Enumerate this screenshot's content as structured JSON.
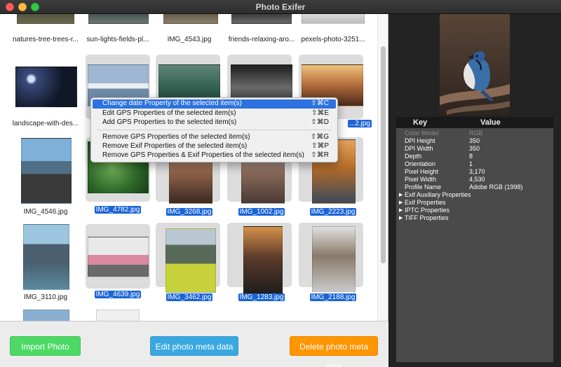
{
  "window": {
    "title": "Photo Exifer"
  },
  "gallery": {
    "row0_labels": [
      "natures-tree-trees-r...",
      "sun-lights-fields-pl...",
      "IMG_4543.jpg",
      "friends-relaxing-aro...",
      "pexels-photo-3251..."
    ],
    "row1_labels": [
      "landscape-with-des...",
      "",
      "",
      "",
      "...2.jpg"
    ],
    "row2_labels": [
      "IMG_4546.jpg",
      "IMG_4782.jpg",
      "IMG_3268.jpg",
      "IMG_1002.jpg",
      "IMG_2223.jpg"
    ],
    "row3_labels": [
      "IMG_3110.jpg",
      "IMG_4639.jpg",
      "IMG_3462.jpg",
      "IMG_1283.jpg",
      "IMG_2188.jpg"
    ]
  },
  "context_menu": {
    "items": [
      {
        "label": "Change date Property of the selected item(s)",
        "shortcut": "⇧⌘C"
      },
      {
        "label": "Edit GPS Properties of the selected item(s)",
        "shortcut": "⇧⌘E"
      },
      {
        "label": "Add GPS Properties to the selected item(s)",
        "shortcut": "⇧⌘D"
      },
      {
        "label": "Remove GPS Properties of the selected item(s)",
        "shortcut": "⇧⌘G"
      },
      {
        "label": "Remove Exif Properties of the selected item(s)",
        "shortcut": "⇧⌘P"
      },
      {
        "label": "Remove GPS Properties & Exif Properties of the selected item(s)",
        "shortcut": "⇧⌘R"
      }
    ]
  },
  "buttons": {
    "import": "Import Photo",
    "edit": "Edit photo meta data",
    "delete": "Delete photo meta data"
  },
  "metadata": {
    "key_header": "Key",
    "value_header": "Value",
    "rows": [
      {
        "key": "Color Model",
        "value": "RGB"
      },
      {
        "key": "DPI Height",
        "value": "350"
      },
      {
        "key": "DPI Width",
        "value": "350"
      },
      {
        "key": "Depth",
        "value": "8"
      },
      {
        "key": "Orientation",
        "value": "1"
      },
      {
        "key": "Pixel Height",
        "value": "3,170"
      },
      {
        "key": "Pixel Width",
        "value": "4,530"
      },
      {
        "key": "Profile Name",
        "value": "Adobe RGB (1998)"
      }
    ],
    "groups": [
      "Exif Auxiliary Properties",
      "Exif Properties",
      "IPTC Properties",
      "TIFF Properties"
    ]
  },
  "colors": {
    "accent_selection": "#1a64d6",
    "import_button": "#4cd964",
    "edit_button": "#3aa8e0",
    "delete_button": "#ff9500"
  }
}
